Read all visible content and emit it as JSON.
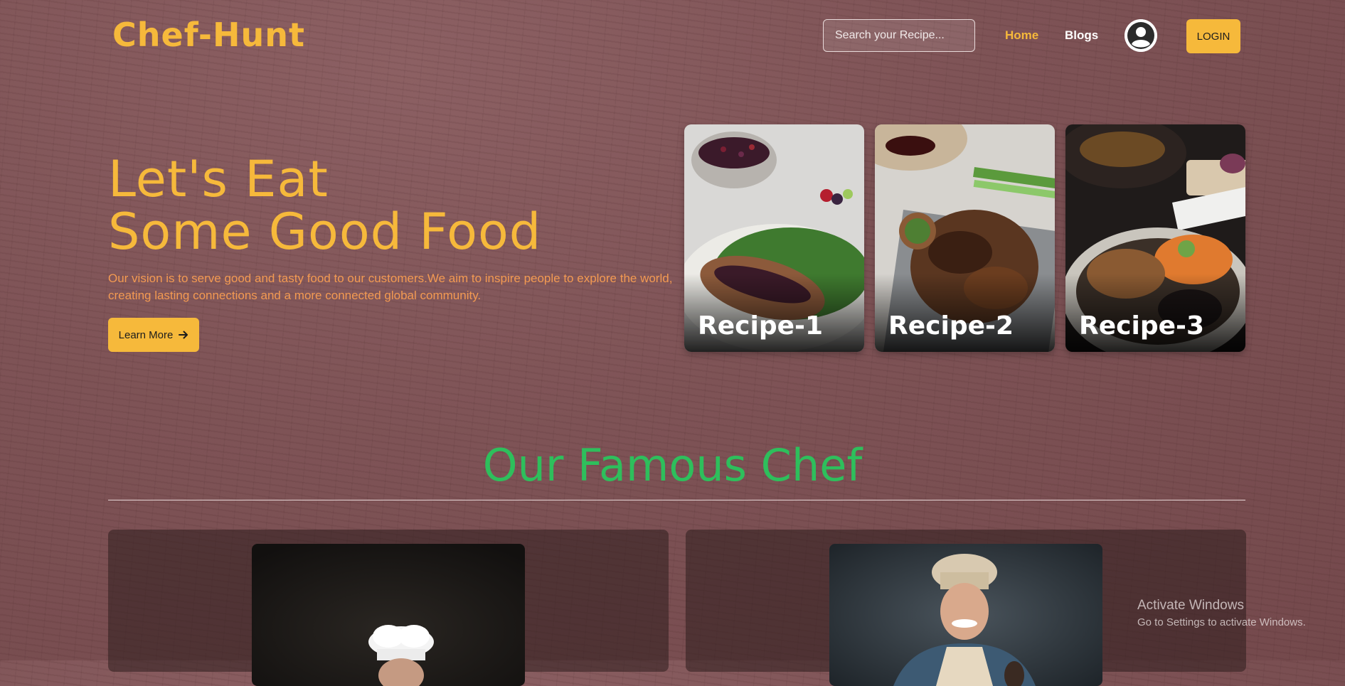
{
  "header": {
    "logo": "Chef-Hunt",
    "search_placeholder": "Search your Recipe...",
    "nav": {
      "home": "Home",
      "blogs": "Blogs"
    },
    "login": "LOGIN"
  },
  "hero": {
    "title_line1": "Let's Eat",
    "title_line2": "Some Good Food",
    "description": "Our vision is to serve good and tasty food to our customers.We aim to inspire people to explore the world, creating lasting connections and a more connected global community.",
    "button": "Learn More",
    "button_icon": "arrow-right-icon"
  },
  "recipes": [
    {
      "title": "Recipe-1"
    },
    {
      "title": "Recipe-2"
    },
    {
      "title": "Recipe-3"
    }
  ],
  "chefs": {
    "title": "Our Famous Chef"
  },
  "system_watermark": {
    "title": "Activate Windows",
    "subtitle": "Go to Settings to activate Windows."
  },
  "colors": {
    "accent": "#f6b93b",
    "section_title": "#2ebf5c",
    "description": "#f39a52"
  }
}
